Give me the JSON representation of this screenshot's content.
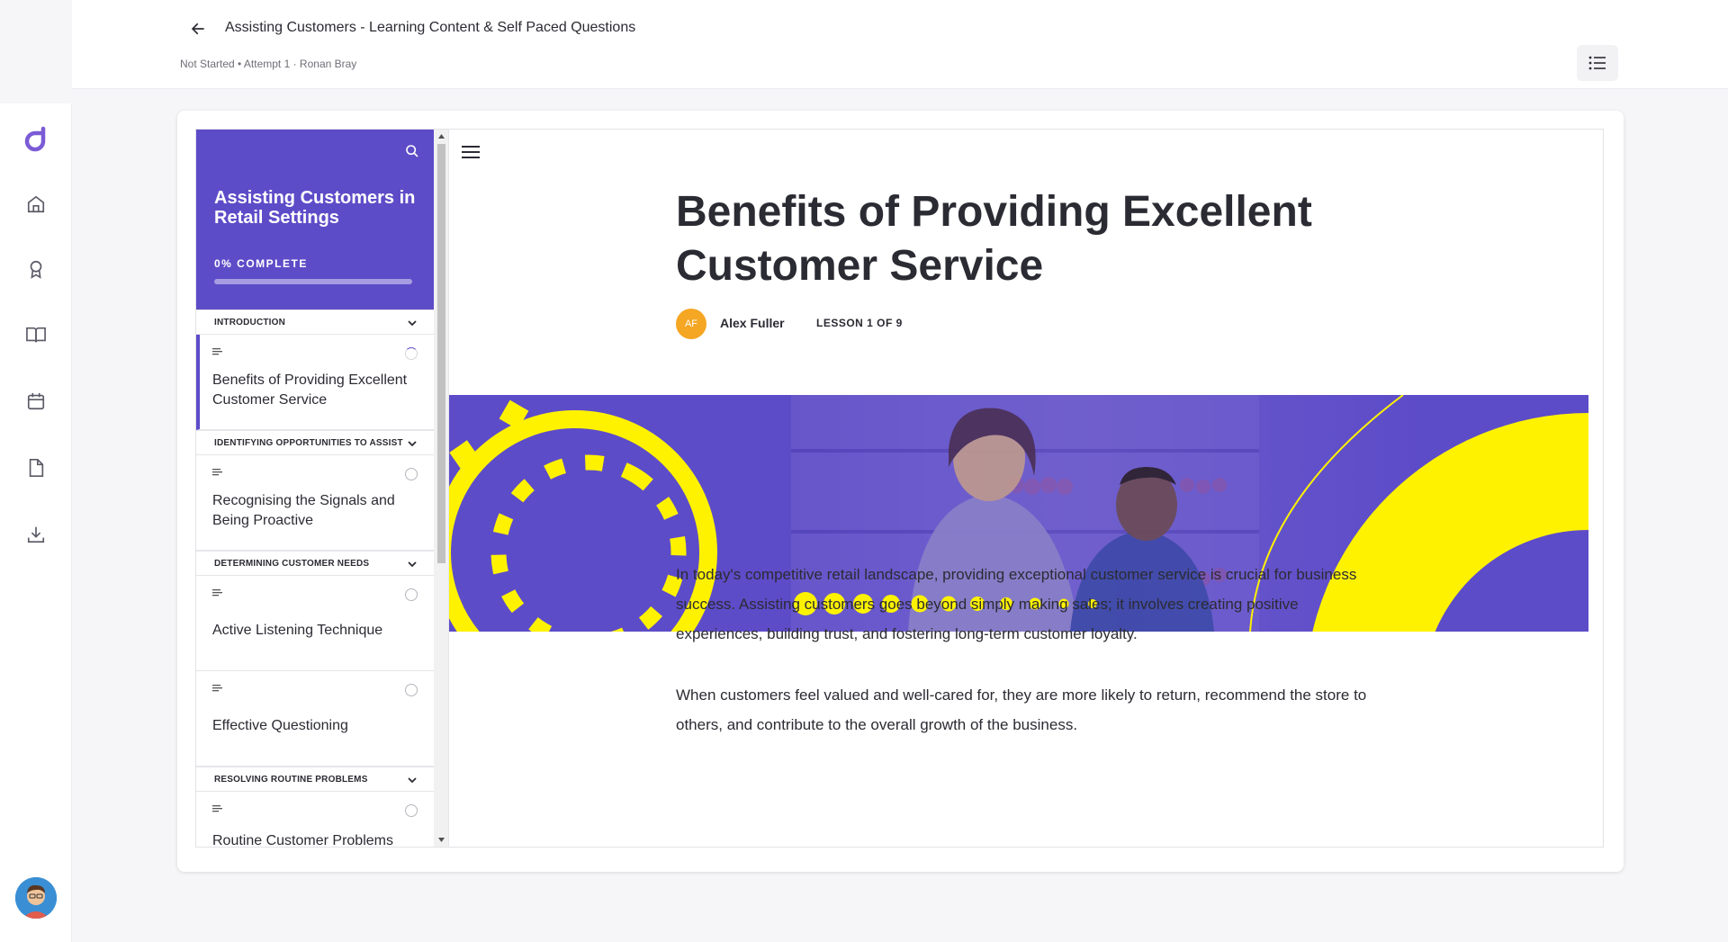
{
  "header": {
    "title": "Assisting Customers - Learning Content & Self Paced Questions",
    "subtitle": "Not Started • Attempt 1 · Ronan Bray"
  },
  "rail": {
    "icons": [
      "home-icon",
      "award-icon",
      "book-icon",
      "calendar-icon",
      "document-icon",
      "download-icon"
    ]
  },
  "sidebar": {
    "course_title": "Assisting Customers in Retail Settings",
    "progress_label": "0% COMPLETE",
    "progress": 0,
    "sections": [
      {
        "label": "INTRODUCTION"
      },
      {
        "label": "IDENTIFYING OPPORTUNITIES TO ASSIST"
      },
      {
        "label": "DETERMINING CUSTOMER NEEDS"
      },
      {
        "label": "RESOLVING ROUTINE PROBLEMS"
      }
    ],
    "lessons": [
      {
        "title": "Benefits of Providing Excellent Customer Service"
      },
      {
        "title": "Recognising the Signals and Being Proactive"
      },
      {
        "title": "Active Listening Technique"
      },
      {
        "title": "Effective Questioning"
      },
      {
        "title": "Routine Customer Problems"
      }
    ]
  },
  "lesson": {
    "heading": "Benefits of Providing Excellent Customer Service",
    "author_initials": "AF",
    "author": "Alex Fuller",
    "count": "LESSON 1 OF 9",
    "paragraphs": [
      "In today's competitive retail landscape, providing exceptional customer service is crucial for business success. Assisting customers goes beyond simply making sales; it involves creating positive experiences, building trust, and fostering long-term customer loyalty.",
      "When customers feel valued and well-cared for, they are more likely to return, recommend the store to others, and contribute to the overall growth of the business."
    ]
  },
  "colors": {
    "brand": "#5d4cc8",
    "banner_accent": "#fff200",
    "author_avatar": "#f5a623"
  }
}
